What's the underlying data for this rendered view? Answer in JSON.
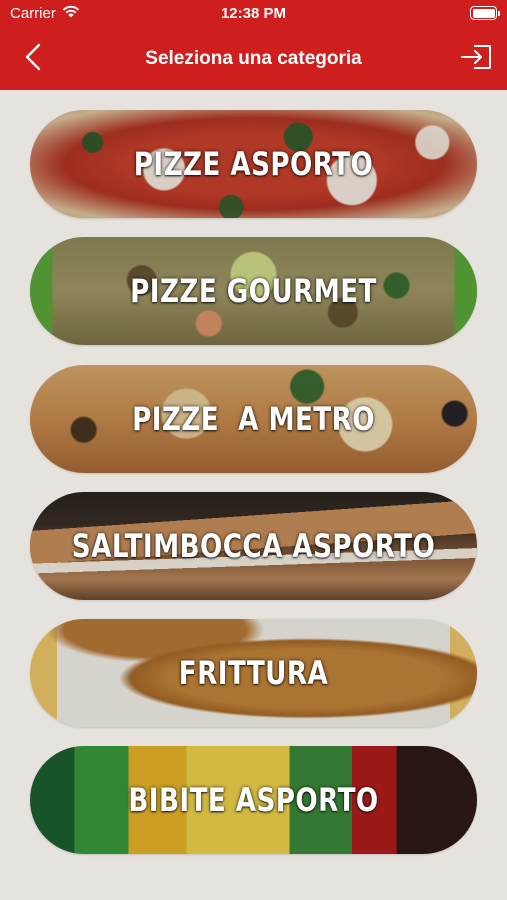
{
  "status_bar": {
    "carrier": "Carrier",
    "time": "12:38 PM",
    "battery_level": 1.0
  },
  "nav": {
    "title": "Seleziona una categoria",
    "back_icon": "chevron-left-icon",
    "logout_icon": "logout-icon"
  },
  "colors": {
    "header": "#cf1e1e",
    "background": "#e6e3de",
    "label_text": "#ffffff"
  },
  "categories": [
    {
      "label": "PIZZE ASPORTO",
      "image": "pizza-margherita-photo"
    },
    {
      "label": "PIZZE GOURMET",
      "image": "pizza-gourmet-photo"
    },
    {
      "label": "PIZZE  A METRO",
      "image": "pizza-metro-photo"
    },
    {
      "label": "SALTIMBOCCA ASPORTO",
      "image": "saltimbocca-photo"
    },
    {
      "label": "FRITTURA",
      "image": "fried-food-photo"
    },
    {
      "label": "BIBITE ASPORTO",
      "image": "soft-drinks-photo"
    }
  ]
}
